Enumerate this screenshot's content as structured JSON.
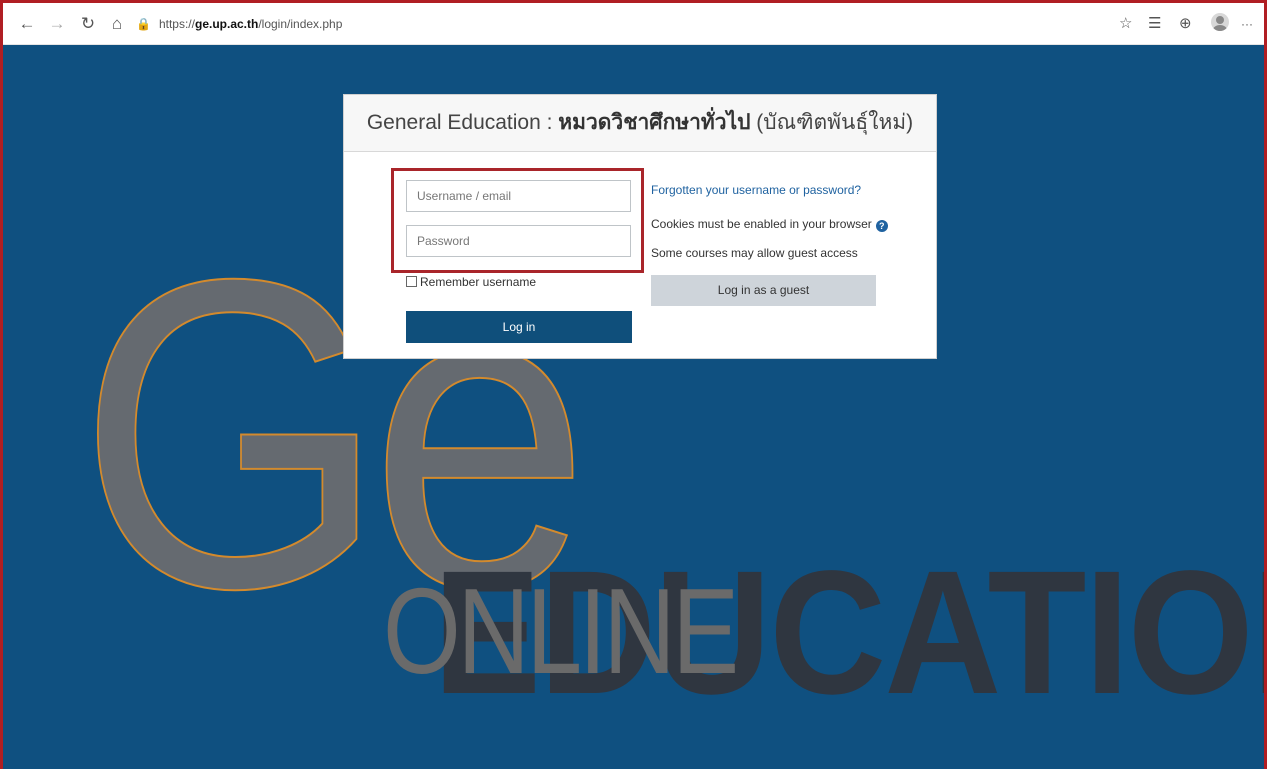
{
  "browser": {
    "url_prefix": "https://",
    "url_domain": "ge.up.ac.th",
    "url_path": "/login/index.php",
    "back_icon": "←",
    "forward_icon": "→",
    "refresh_icon": "↻",
    "home_icon": "⌂",
    "lock_icon": "🔒",
    "favorites_icon": "☆",
    "collections_icon": "☰",
    "extensions_icon": "⊕",
    "more_icon": "···"
  },
  "background": {
    "ge_text": "Ge",
    "online_text": "ONLINE",
    "education_text": "EDUCATION"
  },
  "login": {
    "title_en": "General Education : ",
    "title_th": "หมวดวิชาศึกษาทั่วไป",
    "title_suffix": " (บัณฑิตพันธุ์ใหม่)",
    "username_placeholder": "Username / email",
    "password_placeholder": "Password",
    "remember_label": "Remember username",
    "login_button": "Log in",
    "forgot_link": "Forgotten your username or password?",
    "cookies_text": "Cookies must be enabled in your browser",
    "help_icon": "?",
    "guest_info": "Some courses may allow guest access",
    "guest_button": "Log in as a guest"
  },
  "colors": {
    "page_bg": "#0f5080",
    "primary_button": "#0f4f7b",
    "highlight_border": "#a9252a"
  }
}
